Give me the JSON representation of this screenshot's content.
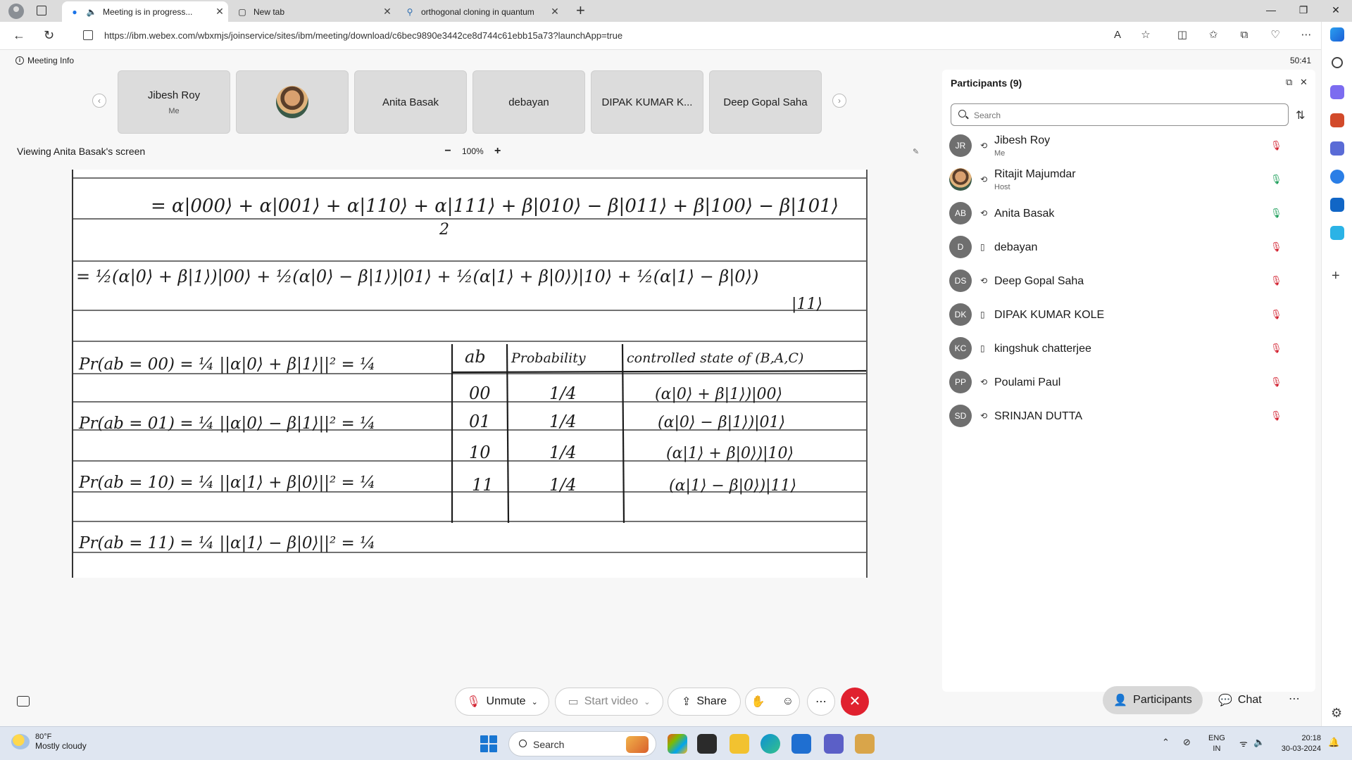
{
  "browser": {
    "tabs": [
      {
        "title": "Meeting is in progress...",
        "icon": "webex-icon",
        "active": true
      },
      {
        "title": "New tab",
        "icon": "newtab-icon",
        "active": false
      },
      {
        "title": "orthogonal cloning in quantum",
        "icon": "search-icon",
        "active": false
      }
    ],
    "url": "https://ibm.webex.com/wbxmjs/joinservice/sites/ibm/meeting/download/c6bec9890e3442ce8d744c61ebb15a73?launchApp=true"
  },
  "meeting": {
    "info_label": "Meeting Info",
    "timer": "50:41",
    "thumbnails": [
      {
        "name": "Jibesh Roy",
        "sub": "Me"
      },
      {
        "name": "",
        "sub": ""
      },
      {
        "name": "Anita Basak",
        "sub": ""
      },
      {
        "name": "debayan",
        "sub": ""
      },
      {
        "name": "DIPAK KUMAR K...",
        "sub": ""
      },
      {
        "name": "Deep Gopal Saha",
        "sub": ""
      }
    ],
    "viewing": "Viewing Anita Basak's screen",
    "zoom": "100%"
  },
  "participants": {
    "title": "Participants (9)",
    "search_placeholder": "Search",
    "list": [
      {
        "initials": "JR",
        "name": "Jibesh Roy",
        "role": "Me",
        "device": "sync",
        "mic": "muted"
      },
      {
        "initials": "",
        "name": "Ritajit Majumdar",
        "role": "Host",
        "device": "sync",
        "mic": "on"
      },
      {
        "initials": "AB",
        "name": "Anita Basak",
        "role": "",
        "device": "sync",
        "mic": "on"
      },
      {
        "initials": "D",
        "name": "debayan",
        "role": "",
        "device": "mobile",
        "mic": "muted"
      },
      {
        "initials": "DS",
        "name": "Deep Gopal Saha",
        "role": "",
        "device": "sync",
        "mic": "muted"
      },
      {
        "initials": "DK",
        "name": "DIPAK KUMAR KOLE",
        "role": "",
        "device": "mobile",
        "mic": "muted"
      },
      {
        "initials": "KC",
        "name": "kingshuk chatterjee",
        "role": "",
        "device": "mobile",
        "mic": "muted"
      },
      {
        "initials": "PP",
        "name": "Poulami Paul",
        "role": "",
        "device": "sync",
        "mic": "muted"
      },
      {
        "initials": "SD",
        "name": "SRINJAN DUTTA",
        "role": "",
        "device": "sync",
        "mic": "muted"
      }
    ]
  },
  "controls": {
    "unmute": "Unmute",
    "start_video": "Start video",
    "share": "Share",
    "participants": "Participants",
    "chat": "Chat"
  },
  "taskbar": {
    "temp": "80°F",
    "weather": "Mostly cloudy",
    "search": "Search",
    "lang1": "ENG",
    "lang2": "IN",
    "time": "20:18",
    "date": "30-03-2024"
  },
  "notes": {
    "line1": "= α|000⟩ + α|001⟩ + α|110⟩ + α|111⟩ + β|010⟩ − β|011⟩ + β|100⟩ − β|101⟩",
    "line1_den": "2",
    "line2": "= ½(α|0⟩ + β|1⟩)|00⟩ + ½(α|0⟩ − β|1⟩)|01⟩ + ½(α|1⟩ + β|0⟩)|10⟩ + ½(α|1⟩ − β|0⟩)",
    "line2_tail": "|11⟩",
    "probs": [
      "Pr(ab = 00) = ¼ ||α|0⟩ + β|1⟩||² = ¼",
      "Pr(ab = 01) = ¼ ||α|0⟩ − β|1⟩||² = ¼",
      "Pr(ab = 10) = ¼ ||α|1⟩ + β|0⟩||² = ¼",
      "Pr(ab = 11) = ¼ ||α|1⟩ − β|0⟩||² = ¼"
    ],
    "table_headers": [
      "ab",
      "Probability",
      "controlled state of (B,A,C)"
    ],
    "table_rows": [
      [
        "00",
        "1/4",
        "(α|0⟩ + β|1⟩)|00⟩"
      ],
      [
        "01",
        "1/4",
        "(α|0⟩ − β|1⟩)|01⟩"
      ],
      [
        "10",
        "1/4",
        "(α|1⟩ + β|0⟩)|10⟩"
      ],
      [
        "11",
        "1/4",
        "(α|1⟩ − β|0⟩)|11⟩"
      ]
    ]
  }
}
